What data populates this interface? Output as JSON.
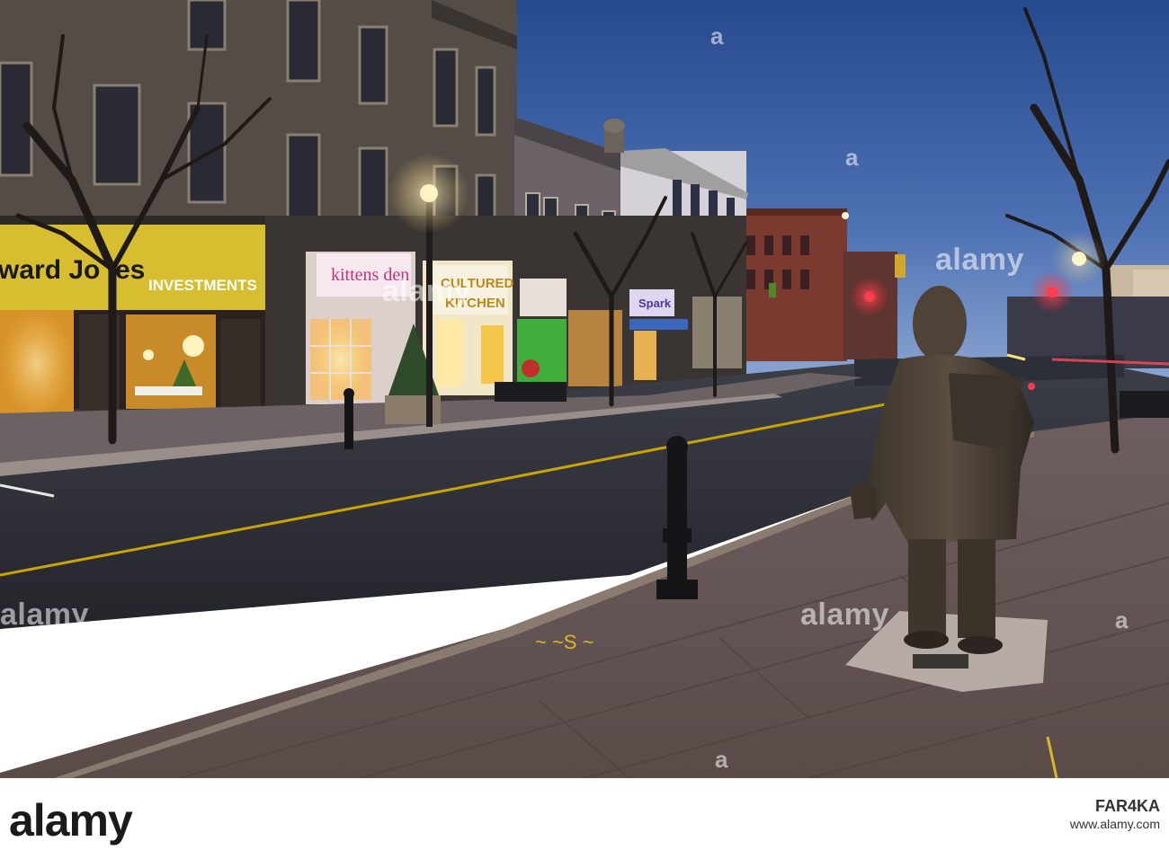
{
  "signs": {
    "edward_jones_left": "ward Jo",
    "edward_jones_right": "es",
    "investments": "INVESTMENTS",
    "kittens_den": "kittens den",
    "cultured_top": "CULTURED",
    "cultured_bottom": "KITCHEN",
    "spark": "Spark"
  },
  "watermark": {
    "text": "alamy",
    "small": "a"
  },
  "footer": {
    "logo": "alamy",
    "image_id": "FAR4KA",
    "url": "www.alamy.com"
  },
  "colors": {
    "sky": "#3a5fa0",
    "storefront_glow": "#f4c24a",
    "edward_jones_banner": "#d9c22a",
    "street_line": "#c8a500",
    "sidewalk": "#6a5a55",
    "statue": "#4a4036",
    "traffic_red": "#ff2a3a"
  }
}
